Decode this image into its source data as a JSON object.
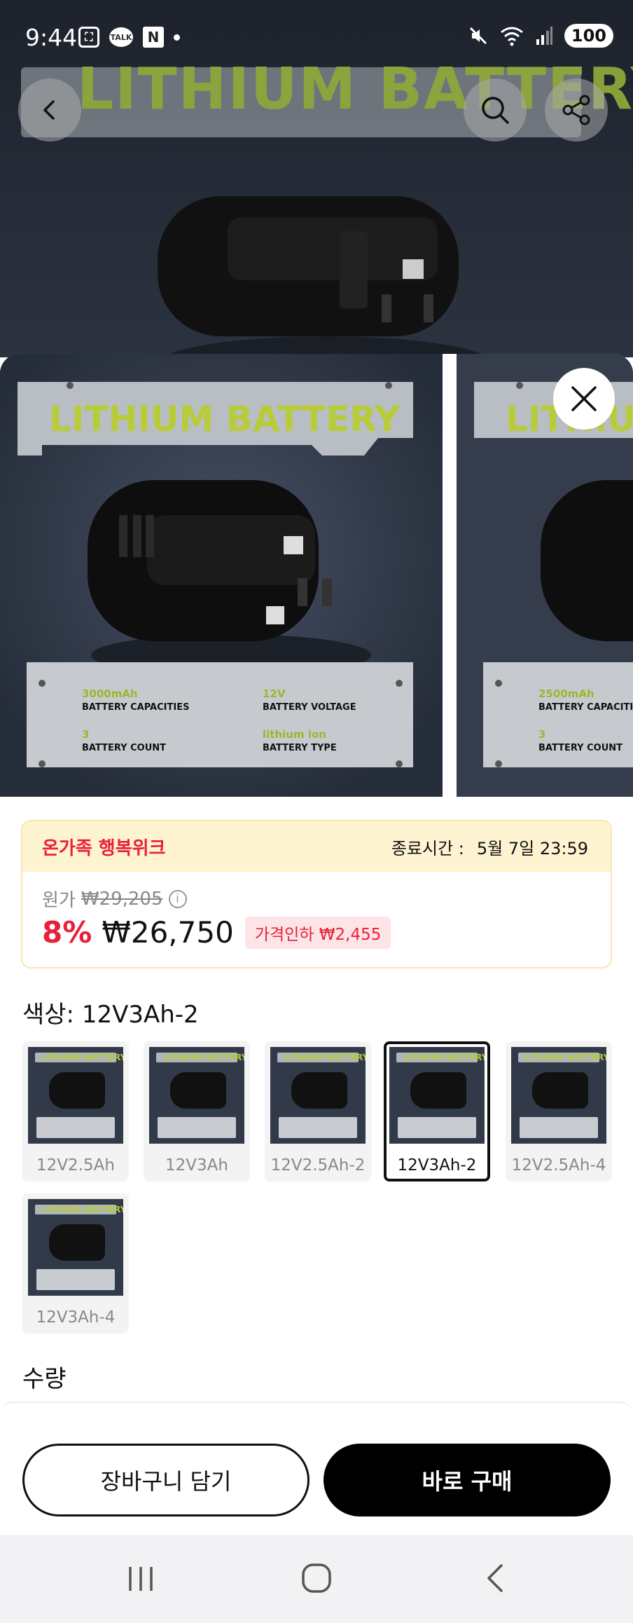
{
  "status_bar": {
    "time": "9:44",
    "left_icons": [
      "screenshot-icon",
      "kakaotalk-icon",
      "naver-icon",
      "dot-icon"
    ],
    "talk_badge": "TALK",
    "naver_badge": "N",
    "right_icons": [
      "mute-icon",
      "wifi-icon",
      "signal-icon"
    ],
    "battery": "100"
  },
  "hero": {
    "banner_text": "LITHIUM BATTERY",
    "buttons": [
      "back-icon",
      "search-icon",
      "share-icon"
    ]
  },
  "viewer": {
    "cards": [
      {
        "banner": "LITHIUM BATTERY",
        "specs": [
          {
            "value": "3000mAh",
            "label": "BATTERY CAPACITIES"
          },
          {
            "value": "12V",
            "label": "BATTERY VOLTAGE"
          },
          {
            "value": "3",
            "label": "BATTERY COUNT"
          },
          {
            "value": "lithium ion",
            "label": "BATTERY TYPE"
          }
        ]
      },
      {
        "banner": "LITHIUM BATTERY",
        "specs": [
          {
            "value": "2500mAh",
            "label": "BATTERY CAPACITIES"
          },
          {
            "value": "3",
            "label": "BATTERY COUNT"
          }
        ]
      }
    ]
  },
  "promo": {
    "title": "온가족 행복위크",
    "end_label": "종료시간 :",
    "end_time": "5월 7일 23:59",
    "original_label": "원가",
    "original_price": "₩29,205",
    "info_icon": "i",
    "discount": "8%",
    "price": "₩26,750",
    "price_cut": "가격인하 ₩2,455"
  },
  "options": {
    "label": "색상: 12V3Ah-2",
    "thumb_text": "LITHIUM BATTERY",
    "items": [
      {
        "label": "12V2.5Ah",
        "selected": false
      },
      {
        "label": "12V3Ah",
        "selected": false
      },
      {
        "label": "12V2.5Ah-2",
        "selected": false
      },
      {
        "label": "12V3Ah-2",
        "selected": true
      },
      {
        "label": "12V2.5Ah-4",
        "selected": false
      },
      {
        "label": "12V3Ah-4",
        "selected": false
      }
    ]
  },
  "quantity": {
    "label": "수량"
  },
  "actions": {
    "cart": "장바구니 담기",
    "buy": "바로 구매"
  },
  "nav_bar": {
    "buttons": [
      "recents-icon",
      "home-icon",
      "back-nav-icon"
    ]
  },
  "colors": {
    "accent_red": "#e8213a",
    "promo_bg": "#fff4d2",
    "banner_green": "#b8cc3a",
    "dark_bg": "#303848"
  }
}
